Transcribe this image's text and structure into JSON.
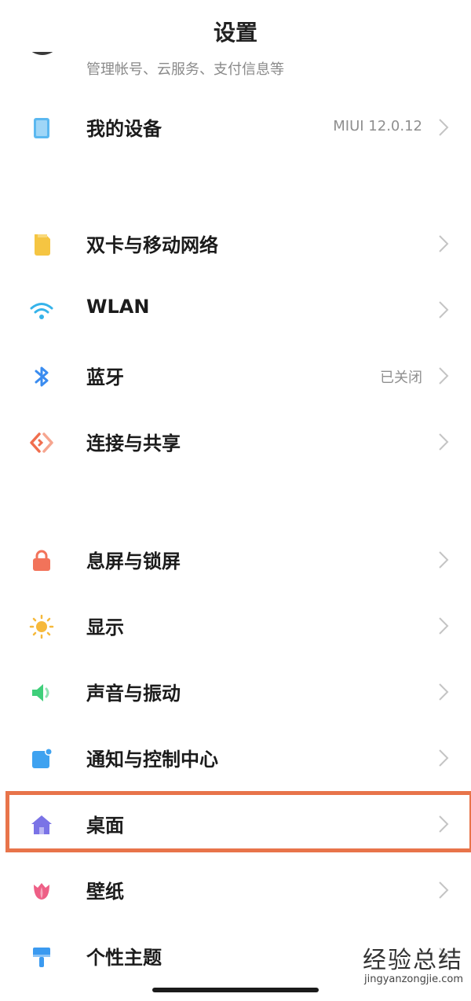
{
  "header": {
    "title": "设置"
  },
  "account": {
    "subtitle": "管理帐号、云服务、支付信息等"
  },
  "rows": [
    {
      "key": "device",
      "label": "我的设备",
      "value": "MIUI 12.0.12",
      "icon": "tablet-icon",
      "color": "#5bb8f0"
    },
    {
      "key": "sim",
      "label": "双卡与移动网络",
      "value": "",
      "icon": "sim-card-icon",
      "color": "#f5c542"
    },
    {
      "key": "wlan",
      "label": "WLAN",
      "value": "",
      "icon": "wifi-icon",
      "color": "#35b3ea"
    },
    {
      "key": "bluetooth",
      "label": "蓝牙",
      "value": "已关闭",
      "icon": "bluetooth-icon",
      "color": "#3a8cf0"
    },
    {
      "key": "connection",
      "label": "连接与共享",
      "value": "",
      "icon": "share-icon",
      "color": "#f06e4e"
    },
    {
      "key": "lockscreen",
      "label": "息屏与锁屏",
      "value": "",
      "icon": "lock-icon",
      "color": "#f2735a"
    },
    {
      "key": "display",
      "label": "显示",
      "value": "",
      "icon": "sun-icon",
      "color": "#f6b93b"
    },
    {
      "key": "sound",
      "label": "声音与振动",
      "value": "",
      "icon": "speaker-icon",
      "color": "#3fcf7a"
    },
    {
      "key": "notification",
      "label": "通知与控制中心",
      "value": "",
      "icon": "notification-icon",
      "color": "#3ea2f0"
    },
    {
      "key": "desktop",
      "label": "桌面",
      "value": "",
      "icon": "home-icon",
      "color": "#7a73e6"
    },
    {
      "key": "wallpaper",
      "label": "壁纸",
      "value": "",
      "icon": "tulip-icon",
      "color": "#ee5f86"
    },
    {
      "key": "theme",
      "label": "个性主题",
      "value": "",
      "icon": "brush-icon",
      "color": "#3b9af0"
    }
  ],
  "accent": {
    "highlight": "#e8744a"
  },
  "watermark": {
    "main": "经验总结",
    "url": "jingyanzongjie.com"
  }
}
